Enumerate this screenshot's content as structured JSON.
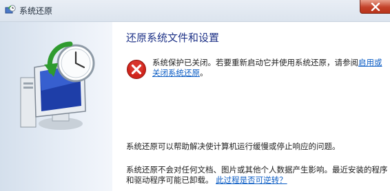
{
  "window": {
    "title": "系统还原",
    "app_icon": "system-restore-icon",
    "close_icon": "close-icon"
  },
  "main": {
    "heading": "还原系统文件和设置",
    "error": {
      "icon": "error-icon",
      "text_before_link": "系统保护已关闭。若要重新启动它并使用系统还原，请参阅",
      "link_text": "启用或关闭系统还原",
      "text_after_link": "。"
    },
    "paragraph1": "系统还原可以帮助解决使计算机运行缓慢或停止响应的问题。",
    "paragraph2": {
      "text": "系统还原不会对任何文档、图片或其他个人数据产生影响。最近安装的程序和驱动程序可能已卸载。",
      "link_text": "此过程是否可逆转？"
    }
  },
  "sidebar": {
    "illustration": "computer-clock-restore-illustration"
  },
  "colors": {
    "heading": "#1e3287",
    "link": "#0b5cc4",
    "error_red": "#d0241b",
    "close_red": "#c4432b",
    "sidebar": "#d4dfec"
  }
}
